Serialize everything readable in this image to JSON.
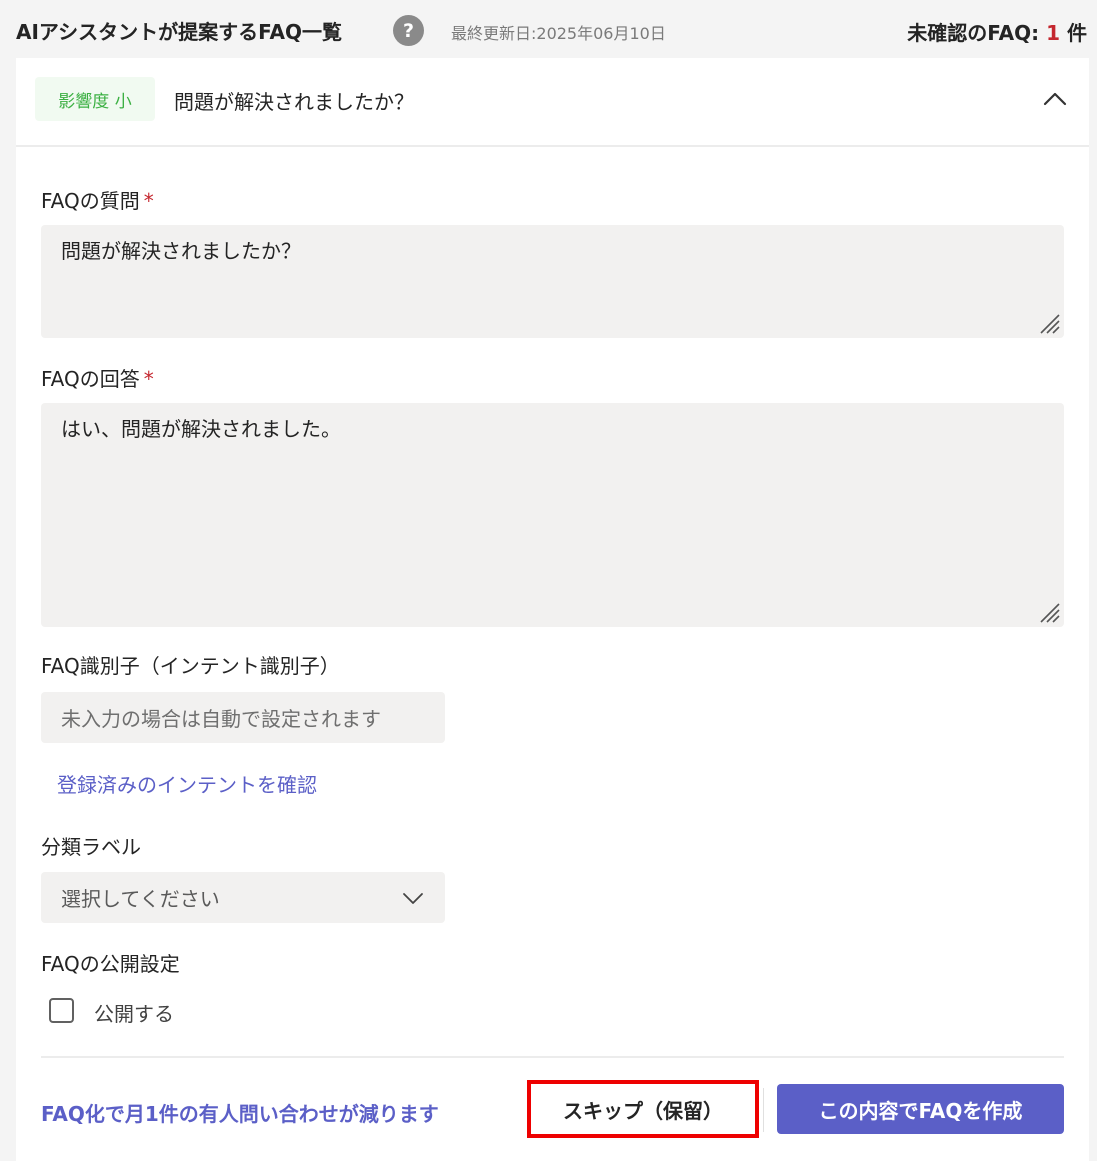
{
  "header": {
    "title": "AIアシスタントが提案するFAQ一覧",
    "help_label": "?",
    "last_updated": "最終更新日:2025年06月10日",
    "unconfirmed_label": "未確認のFAQ: ",
    "unconfirmed_count": "1",
    "unconfirmed_unit": " 件"
  },
  "card": {
    "impact_badge": "影響度 小",
    "question_summary": "問題が解決されましたか？"
  },
  "form": {
    "required_mark": "*",
    "question_label": "FAQの質問",
    "question_value": "問題が解決されましたか？",
    "answer_label": "FAQの回答",
    "answer_value": "はい、問題が解決されました。",
    "identifier_label": "FAQ識別子（インテント識別子）",
    "identifier_placeholder": "未入力の場合は自動で設定されます",
    "intent_link": "登録済みのインテントを確認",
    "category_label": "分類ラベル",
    "category_selected": "選択してください",
    "publish_label": "FAQの公開設定",
    "publish_checkbox_label": "公開する"
  },
  "footer": {
    "note": "FAQ化で月1件の有人問い合わせが減ります",
    "skip_label": "スキップ（保留）",
    "create_label": "この内容でFAQを作成"
  },
  "colors": {
    "accent": "#5b5fc7",
    "required": "#c4262e",
    "badge_text": "#3cb043",
    "highlight_border": "#ee0000"
  }
}
